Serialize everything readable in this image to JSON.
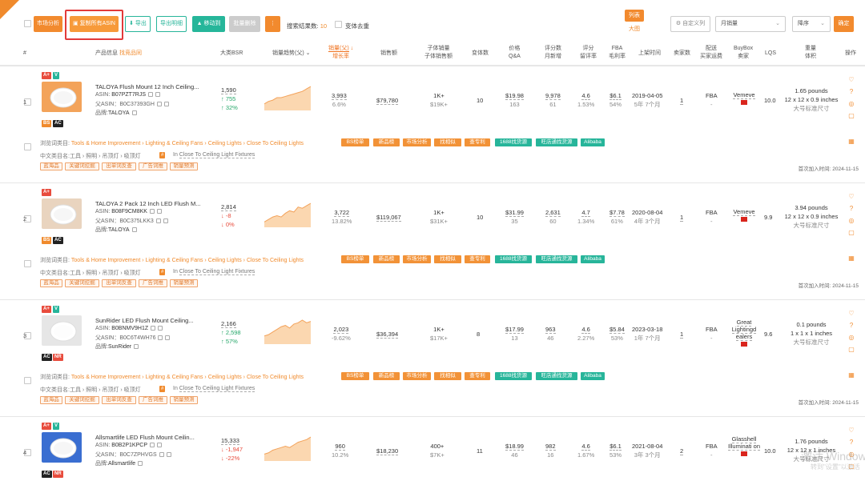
{
  "toolbar": {
    "market_analysis": "市场分析",
    "copy_asin": "复制所有ASIN",
    "export": "导出",
    "export_detail": "导出明细",
    "move_to": "移动到",
    "batch_delete": "批量删除",
    "more": "⋮",
    "result_label": "搜索结果数:",
    "result_count": "10",
    "variant_dedupe": "变体去重",
    "toggle_list": "列表",
    "toggle_grid": "大图",
    "custom_columns": "自定义列",
    "sort_field": "月销量",
    "sort_order": "降序",
    "confirm": "确定"
  },
  "columns": {
    "index": "#",
    "product_info": "产品信息",
    "product_info_link": "找竞品同",
    "bsr": "大类BSR",
    "sales_trend": "销量趋势(父)",
    "sales_parent": "销量(父)",
    "sales_growth": "增长率",
    "revenue": "销售额",
    "child_sales": "子体销量",
    "child_revenue": "子体销售额",
    "variants": "变体数",
    "price": "价格",
    "qa": "Q&A",
    "ratings": "评分数",
    "monthly_new": "月新增",
    "rating": "评分",
    "rating_rate": "留评率",
    "fba": "FBA",
    "margin": "毛利率",
    "launch": "上架时间",
    "sellers": "卖家数",
    "delivery": "配送",
    "buy_method": "买家运费",
    "buybox": "BuyBox",
    "buybox_seller": "卖家",
    "lqs": "LQS",
    "weight": "重量",
    "volume": "体积",
    "actions": "操作"
  },
  "row_labels": {
    "asin": "ASIN: ",
    "parent_asin": "父ASIN：",
    "brand": "品牌:",
    "browse_cat": "浏览词类目:",
    "cn_cat": "中文类目名:",
    "cn_in": "In",
    "first_add": "首次加入时间:"
  },
  "cat_tags": [
    "BS榜单",
    "新品榜",
    "市场分析",
    "找相似",
    "查专利",
    "1688找货源",
    "阿里巴巴"
  ],
  "cat_tags_green": [
    "1688找货源",
    "旺店通找货源",
    "Alibaba"
  ],
  "small_tags": [
    "蓝海品",
    "关键词挖掘",
    "出单词反查",
    "广告词推",
    "销量预测"
  ],
  "products": [
    {
      "index": "1",
      "badges_top": [
        "A+",
        "V"
      ],
      "badges_bottom": [
        "BS",
        "AC"
      ],
      "title": "TALOYA Flush Mount 12 Inch Ceiling...",
      "asin": "B07PZT7RJS",
      "parent_asin": "B0C37393GH",
      "brand": "TALOYA",
      "bsr": "1,590",
      "bsr_change": "↑ 755",
      "bsr_pct": "↑ 32%",
      "bsr_dir": "up",
      "sales": "3,993",
      "growth": "6.6%",
      "revenue": "$79,780",
      "child_sales": "1K+",
      "child_revenue": "$19K+",
      "variants": "10",
      "price": "$19.98",
      "qa": "163",
      "ratings": "9,978",
      "monthly_new": "61",
      "rating": "4.6",
      "rating_rate": "1.53%",
      "fba": "$6.1",
      "margin": "54%",
      "launch": "2019-04-05",
      "launch_age": "5年 7个月",
      "sellers": "1",
      "delivery": "FBA",
      "delivery_fee": "-",
      "buybox": "Vemeve",
      "lqs": "10.0",
      "weight": "1.65 pounds",
      "dims": "12 x 12 x 0.9 inches",
      "size": "大号标准尺寸",
      "category": "Tools & Home Improvement › Lighting & Ceiling Fans › Ceiling Lights › Close To Ceiling Lights",
      "cn_path": "工具 › 照明 › 吊顶灯 › 吸顶灯",
      "cn_leaf": "Close To Ceiling Light Fixtures",
      "first_add": "2024-11-15",
      "spark": [
        4,
        6,
        7,
        9,
        9,
        10,
        11,
        12,
        13,
        14,
        16,
        18
      ]
    },
    {
      "index": "2",
      "badges_top": [
        "A+"
      ],
      "badges_bottom": [
        "BS",
        "AC"
      ],
      "title": "TALOYA 2 Pack 12 Inch LED Flush M...",
      "asin": "B08F9CM8KK",
      "parent_asin": "B0C375LKK3",
      "brand": "TALOYA",
      "bsr": "2,814",
      "bsr_change": "↓ -8",
      "bsr_pct": "↓ 0%",
      "bsr_dir": "down",
      "sales": "3,722",
      "growth": "13.82%",
      "revenue": "$119,067",
      "child_sales": "1K+",
      "child_revenue": "$31K+",
      "variants": "10",
      "price": "$31.99",
      "qa": "35",
      "ratings": "2,631",
      "monthly_new": "60",
      "rating": "4.7",
      "rating_rate": "1.34%",
      "fba": "$7.78",
      "margin": "61%",
      "launch": "2020-08-04",
      "launch_age": "4年 3个月",
      "sellers": "1",
      "delivery": "FBA",
      "delivery_fee": "-",
      "buybox": "Vemeve",
      "lqs": "9.9",
      "weight": "3.94 pounds",
      "dims": "12 x 12 x 0.9 inches",
      "size": "大号标准尺寸",
      "category": "Tools & Home Improvement › Lighting & Ceiling Fans › Ceiling Lights › Close To Ceiling Lights",
      "cn_path": "工具 › 照明 › 吊顶灯 › 吸顶灯",
      "cn_leaf": "Close To Ceiling Light Fixtures",
      "first_add": "2024-11-15",
      "spark": [
        3,
        5,
        7,
        8,
        7,
        10,
        12,
        11,
        15,
        14,
        16,
        18
      ]
    },
    {
      "index": "3",
      "badges_top": [
        "A+",
        "V"
      ],
      "badges_bottom": [
        "AC",
        "NR"
      ],
      "title": "SunRider LED Flush Mount Ceiling...",
      "asin": "B0BNMV9H1Z",
      "parent_asin": "B0C6T4WH76",
      "brand": "SunRider",
      "bsr": "2,166",
      "bsr_change": "↑ 2,598",
      "bsr_pct": "↑ 57%",
      "bsr_dir": "up",
      "sales": "2,023",
      "growth": "-9.62%",
      "revenue": "$36,394",
      "child_sales": "1K+",
      "child_revenue": "$17K+",
      "variants": "8",
      "price": "$17.99",
      "qa": "13",
      "ratings": "963",
      "monthly_new": "46",
      "rating": "4.6",
      "rating_rate": "2.27%",
      "fba": "$5.84",
      "margin": "53%",
      "launch": "2023-03-18",
      "launch_age": "1年 7个月",
      "sellers": "1",
      "delivery": "FBA",
      "delivery_fee": "-",
      "buybox": "Great Lightingd ealers",
      "lqs": "9.6",
      "weight": "0.1 pounds",
      "dims": "1 x 1 x 1 inches",
      "size": "大号标准尺寸",
      "category": "Tools & Home Improvement › Lighting & Ceiling Fans › Ceiling Lights › Close To Ceiling Lights",
      "cn_path": "工具 › 照明 › 吊顶灯 › 吸顶灯",
      "cn_leaf": "Close To Ceiling Light Fixtures",
      "first_add": "2024-11-15",
      "spark": [
        5,
        6,
        8,
        10,
        12,
        13,
        11,
        14,
        15,
        17,
        15,
        16
      ]
    },
    {
      "index": "4",
      "badges_top": [
        "A+",
        "V"
      ],
      "badges_bottom": [
        "AC",
        "NR"
      ],
      "title": "Allsmartlife LED Flush Mount Ceilin...",
      "asin": "B0B2P1KPCP",
      "parent_asin": "B0C7ZPHVGS",
      "brand": "Allsmartlife",
      "bsr": "15,333",
      "bsr_change": "↓ -1,947",
      "bsr_pct": "↓ -22%",
      "bsr_dir": "down",
      "sales": "960",
      "growth": "10.2%",
      "revenue": "$18,230",
      "child_sales": "400+",
      "child_revenue": "$7K+",
      "variants": "11",
      "price": "$18.99",
      "qa": "46",
      "ratings": "982",
      "monthly_new": "16",
      "rating": "4.6",
      "rating_rate": "1.67%",
      "fba": "$6.1",
      "margin": "53%",
      "launch": "2021-08-04",
      "launch_age": "3年 3个月",
      "sellers": "2",
      "delivery": "FBA",
      "delivery_fee": "-",
      "buybox": "Glasshell Illuminati on",
      "lqs": "10.0",
      "weight": "1.76 pounds",
      "dims": "12 x 12 x 1 inches",
      "size": "大号标准尺寸",
      "spark": [
        4,
        5,
        7,
        8,
        9,
        10,
        9,
        11,
        13,
        14,
        15,
        17
      ]
    }
  ],
  "colors": {
    "accent": "#f08a2c",
    "green": "#27b59a",
    "red": "#e84c3d"
  },
  "watermark": "激活 Windows",
  "watermark_sub": "转到\"设置\"以激活"
}
